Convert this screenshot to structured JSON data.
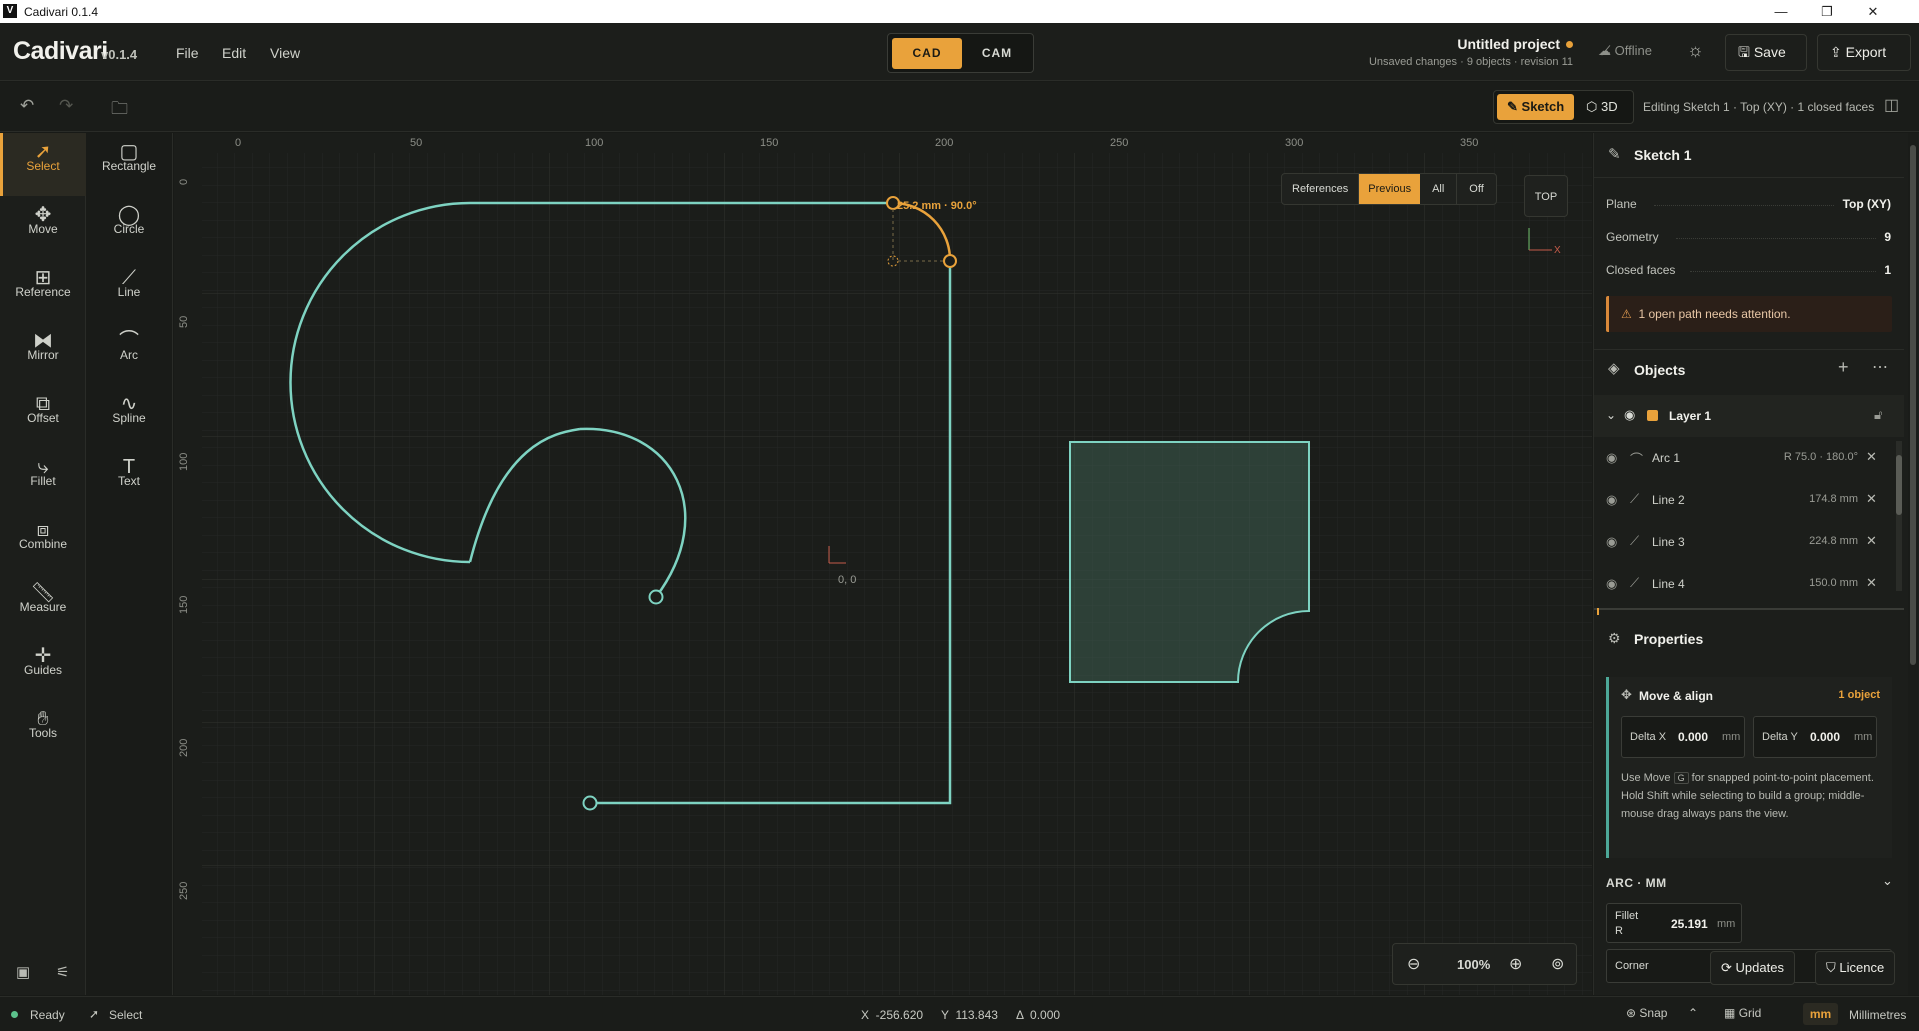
{
  "window": {
    "title": "Cadivari 0.1.4",
    "logo_letter": "V",
    "controls": [
      "—",
      "❐",
      "✕"
    ]
  },
  "app": {
    "brand": "Cadivari",
    "version": "v0.1.4"
  },
  "menu": [
    "File",
    "Edit",
    "View"
  ],
  "modes": {
    "cad": "CAD",
    "cam": "CAM",
    "active": "CAD"
  },
  "project": {
    "name": "Untitled project",
    "status": "Unsaved changes · 9 objects · revision 11"
  },
  "header": {
    "offline": "Offline",
    "save": "Save",
    "export": "Export"
  },
  "view_toggle": {
    "sketch": "Sketch",
    "three_d": "3D",
    "active": "Sketch",
    "editing": "Editing Sketch 1 · Top (XY) · 1 closed faces"
  },
  "tools_primary": [
    {
      "label": "Select",
      "icon": "pointer-icon",
      "active": true
    },
    {
      "label": "Move",
      "icon": "move-icon"
    },
    {
      "label": "Reference",
      "icon": "image-plus-icon"
    },
    {
      "label": "Mirror",
      "icon": "mirror-icon"
    },
    {
      "label": "Offset",
      "icon": "offset-icon"
    },
    {
      "label": "Fillet",
      "icon": "fillet-icon"
    },
    {
      "label": "Combine",
      "icon": "combine-icon"
    },
    {
      "label": "Measure",
      "icon": "ruler-icon"
    },
    {
      "label": "Guides",
      "icon": "guides-icon"
    },
    {
      "label": "Tools",
      "icon": "hand-icon"
    }
  ],
  "tools_shapes": [
    {
      "label": "Rectangle",
      "icon": "rectangle-icon"
    },
    {
      "label": "Circle",
      "icon": "circle-icon"
    },
    {
      "label": "Line",
      "icon": "line-icon"
    },
    {
      "label": "Arc",
      "icon": "arc-icon"
    },
    {
      "label": "Spline",
      "icon": "spline-icon"
    },
    {
      "label": "Text",
      "icon": "text-icon"
    }
  ],
  "canvas": {
    "ruler_x": [
      "0",
      "50",
      "100",
      "150",
      "200",
      "250",
      "300",
      "350"
    ],
    "ruler_y": [
      "0",
      "50",
      "100",
      "150",
      "200",
      "250"
    ],
    "origin_label": "0, 0",
    "dimension_label": "25.2 mm · 90.0°",
    "reference_filter": {
      "label": "References",
      "options": [
        "Previous",
        "All",
        "Off"
      ],
      "active": "Previous"
    },
    "view_cube": "TOP",
    "axis_x": "X",
    "zoom": "100%"
  },
  "sketch_panel": {
    "title": "Sketch 1",
    "props": [
      {
        "key": "Plane",
        "value": "Top (XY)"
      },
      {
        "key": "Geometry",
        "value": "9"
      },
      {
        "key": "Closed faces",
        "value": "1"
      }
    ],
    "warning": "1 open path needs attention."
  },
  "objects": {
    "title": "Objects",
    "layer": "Layer 1",
    "items": [
      {
        "name": "Arc 1",
        "meta": "R 75.0 · 180.0°"
      },
      {
        "name": "Line 2",
        "meta": "174.8 mm"
      },
      {
        "name": "Line 3",
        "meta": "224.8 mm"
      },
      {
        "name": "Line 4",
        "meta": "150.0 mm"
      }
    ]
  },
  "properties": {
    "title": "Properties",
    "move_align": {
      "title": "Move & align",
      "count": "1 object"
    },
    "delta_x": {
      "label": "Delta X",
      "value": "0.000",
      "unit": "mm"
    },
    "delta_y": {
      "label": "Delta Y",
      "value": "0.000",
      "unit": "mm"
    },
    "help_pre": "Use Move",
    "help_key": "G",
    "help_post": "for snapped point-to-point placement. Hold Shift while selecting to build a group; middle-mouse drag always pans the view.",
    "arc_section": "ARC · MM",
    "fillet": {
      "label_line1": "Fillet",
      "label_line2": "R",
      "value": "25.191",
      "unit": "mm"
    },
    "corner": "Corner",
    "updates": "Updates",
    "licence": "Licence"
  },
  "status": {
    "ready": "Ready",
    "tool": "Select",
    "x": "X  -256.620",
    "y": "Y  113.843",
    "delta": "Δ  0.000",
    "snap": "Snap",
    "grid": "Grid",
    "unit_short": "mm",
    "unit_long": "Millimetres"
  },
  "colors": {
    "accent": "#e9a23b",
    "path": "#7ed3c2",
    "bg": "#181a17"
  }
}
